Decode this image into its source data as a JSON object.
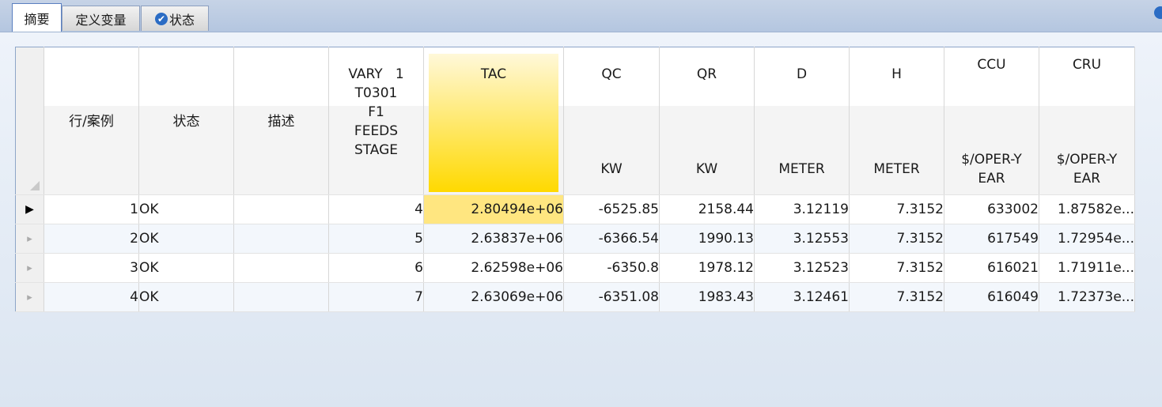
{
  "tabs": [
    {
      "label": "摘要"
    },
    {
      "label": "定义变量"
    },
    {
      "label": "状态"
    }
  ],
  "columns": [
    {
      "top": "",
      "unit": "行/案例"
    },
    {
      "top": "",
      "unit": "状态"
    },
    {
      "top": "",
      "unit": "描述"
    },
    {
      "top": "VARY   1\nT0301\nF1\nFEEDS\nSTAGE",
      "unit": ""
    },
    {
      "top": "TAC",
      "unit": ""
    },
    {
      "top": "QC",
      "unit": "KW"
    },
    {
      "top": "QR",
      "unit": "KW"
    },
    {
      "top": "D",
      "unit": "METER"
    },
    {
      "top": "H",
      "unit": "METER"
    },
    {
      "top": "CCU",
      "unit": "$/OPER-Y\nEAR"
    },
    {
      "top": "CRU",
      "unit": "$/OPER-Y\nEAR"
    }
  ],
  "rows": [
    {
      "case": "1",
      "status": "OK",
      "desc": "",
      "vary": "4",
      "tac": "2.80494e+06",
      "qc": "-6525.85",
      "qr": "2158.44",
      "d": "3.12119",
      "h": "7.3152",
      "ccu": "633002",
      "cru": "1.87582e..."
    },
    {
      "case": "2",
      "status": "OK",
      "desc": "",
      "vary": "5",
      "tac": "2.63837e+06",
      "qc": "-6366.54",
      "qr": "1990.13",
      "d": "3.12553",
      "h": "7.3152",
      "ccu": "617549",
      "cru": "1.72954e..."
    },
    {
      "case": "3",
      "status": "OK",
      "desc": "",
      "vary": "6",
      "tac": "2.62598e+06",
      "qc": "-6350.8",
      "qr": "1978.12",
      "d": "3.12523",
      "h": "7.3152",
      "ccu": "616021",
      "cru": "1.71911e..."
    },
    {
      "case": "4",
      "status": "OK",
      "desc": "",
      "vary": "7",
      "tac": "2.63069e+06",
      "qc": "-6351.08",
      "qr": "1983.43",
      "d": "3.12461",
      "h": "7.3152",
      "ccu": "616049",
      "cru": "1.72373e..."
    }
  ],
  "row_indicator": {
    "current": "▶",
    "other": "▸"
  },
  "icons": {
    "tab_status": "checkmark-circle-icon"
  },
  "colors": {
    "highlight_column": "#ffd900",
    "accent": "#2b6cc4"
  }
}
